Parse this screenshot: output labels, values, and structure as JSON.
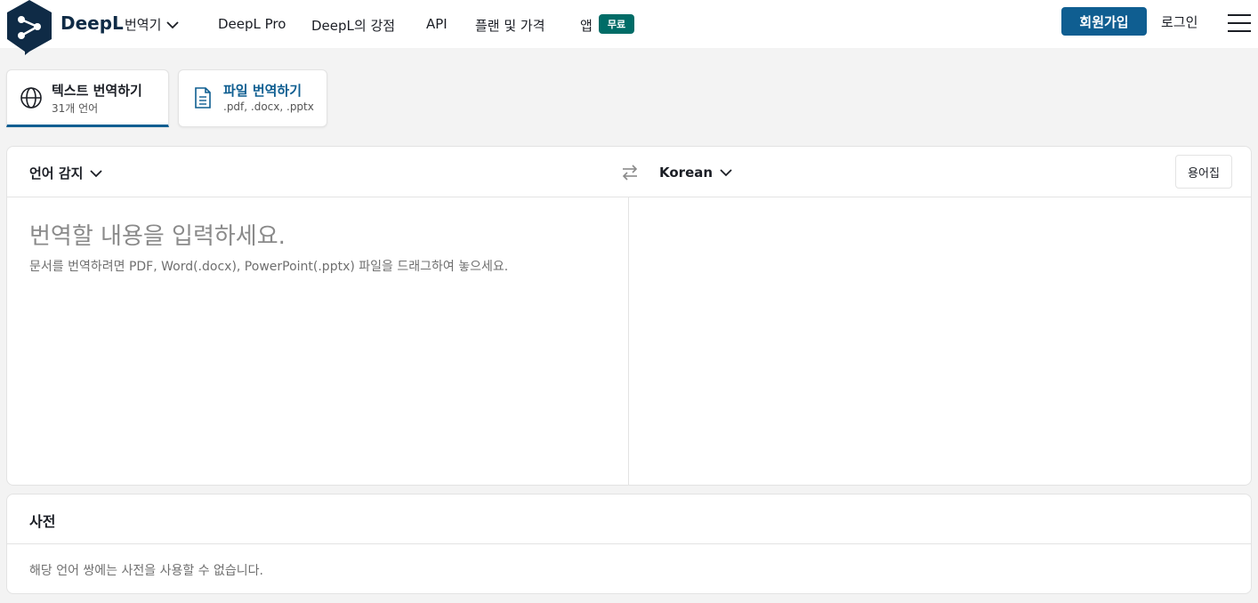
{
  "header": {
    "brand": "DeepL",
    "product": "번역기",
    "nav": [
      {
        "label": "DeepL Pro"
      },
      {
        "label": "DeepL의 강점"
      },
      {
        "label": "API"
      },
      {
        "label": "플랜 및 가격"
      },
      {
        "label": "앱"
      }
    ],
    "free_badge": "무료",
    "signup": "회원가입",
    "login": "로그인",
    "brand_color": "#0f2b46",
    "accent_color": "#0f5e91",
    "badge_color": "#006c67"
  },
  "tabs": [
    {
      "title": "텍스트 번역하기",
      "subtitle": "31개 언어",
      "icon": "globe-icon",
      "active": true
    },
    {
      "title": "파일 번역하기",
      "subtitle": ".pdf, .docx, .pptx",
      "icon": "document-icon",
      "active": false
    }
  ],
  "translator": {
    "source_language": "언어 감지",
    "target_language": "Korean",
    "glossary": "용어집",
    "placeholder": "번역할 내용을 입력하세요.",
    "placeholder_hint": "문서를 번역하려면 PDF, Word(.docx), PowerPoint(.pptx) 파일을 드래그하여 놓으세요."
  },
  "dictionary": {
    "title": "사전",
    "message": "해당 언어 쌍에는 사전을 사용할 수 없습니다."
  }
}
